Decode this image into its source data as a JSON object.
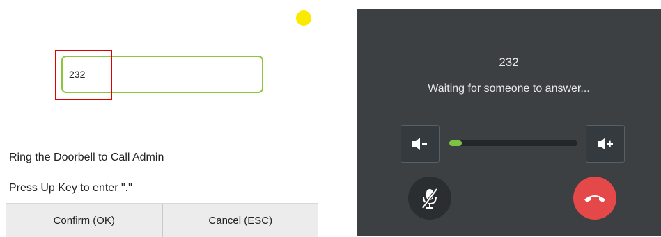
{
  "dialog": {
    "input_value": "232",
    "hint_doorbell": "Ring the Doorbell to Call Admin",
    "hint_dot": "Press Up Key to enter \".\"",
    "confirm_label": "Confirm (OK)",
    "cancel_label": "Cancel (ESC)"
  },
  "call": {
    "number": "232",
    "status": "Waiting for someone to answer...",
    "volume_level": 0.1
  },
  "icons": {
    "volume_down": "volume-down-icon",
    "volume_up": "volume-up-icon",
    "mute": "microphone-muted-icon",
    "hangup": "hang-up-icon"
  },
  "colors": {
    "input_border": "#8cc63f",
    "highlight": "#e00000",
    "indicator": "#f9ea00",
    "call_background": "#3c4043",
    "volume_fill": "#7dc242",
    "hangup": "#e54848"
  }
}
